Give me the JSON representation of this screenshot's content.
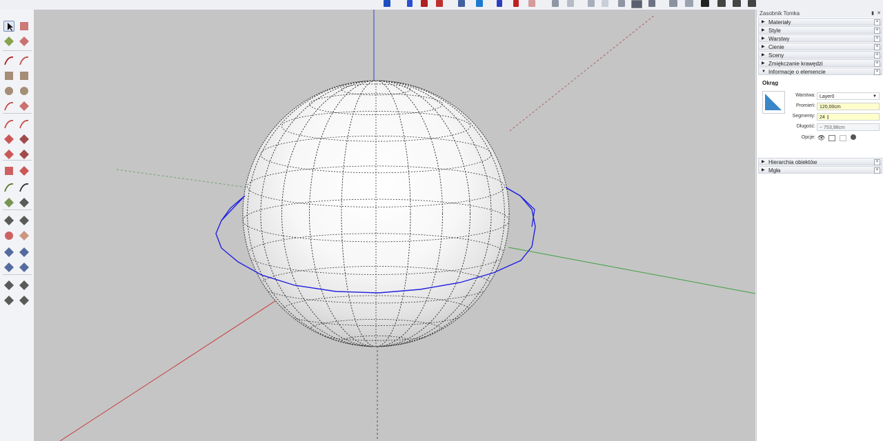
{
  "tray": {
    "title": "Zasobnik Tomka",
    "pin_icon": "pin-icon",
    "close_icon": "close-icon",
    "panels_top": [
      {
        "label": "Materiały",
        "state": "collapsed"
      },
      {
        "label": "Style",
        "state": "collapsed"
      },
      {
        "label": "Warstwy",
        "state": "collapsed"
      },
      {
        "label": "Cienie",
        "state": "collapsed"
      },
      {
        "label": "Sceny",
        "state": "collapsed"
      },
      {
        "label": "Zmiękczanie krawędzi",
        "state": "collapsed"
      },
      {
        "label": "Informacje o elemencie",
        "state": "expanded"
      }
    ],
    "entity_info": {
      "type": "Okrąg",
      "layer_label": "Warstwa:",
      "layer_value": "Layer0",
      "radius_label": "Promień:",
      "radius_value": "120,00cm",
      "segments_label": "Segmenty:",
      "segments_value": "24",
      "length_label": "Długość:",
      "length_value": "~ 753,98cm",
      "options_label": "Opcje:"
    },
    "panels_bottom": [
      {
        "label": "Hierarchia obiektów",
        "state": "collapsed"
      },
      {
        "label": "Mgła",
        "state": "collapsed"
      }
    ]
  },
  "colors": {
    "viewport_bg": "#c5c5c5",
    "circle_selected": "#2020e0",
    "axis_blue": "#3a3ad0",
    "axis_red": "#c83a3a",
    "axis_green": "#3aa03a",
    "highlight_field": "#ffffcc"
  },
  "toolbar_icons": [
    "select-icon",
    "component-icon",
    "paint-bucket-icon",
    "eraser-icon",
    "line-icon",
    "freehand-icon",
    "rectangle-icon",
    "rotated-rectangle-icon",
    "circle-icon",
    "polygon-icon",
    "arc-icon",
    "pie-icon",
    "two-point-arc-icon",
    "three-point-arc-icon",
    "move-icon",
    "push-pull-icon",
    "rotate-icon",
    "follow-me-icon",
    "scale-icon",
    "offset-icon",
    "tape-measure-icon",
    "dimension-icon",
    "protractor-icon",
    "text-icon",
    "axes-icon",
    "3d-text-icon",
    "orbit-icon",
    "pan-icon",
    "zoom-icon",
    "zoom-window-icon",
    "zoom-extents-icon",
    "previous-view-icon",
    "position-camera-icon",
    "look-around-icon",
    "walk-icon",
    "section-plane-icon"
  ]
}
